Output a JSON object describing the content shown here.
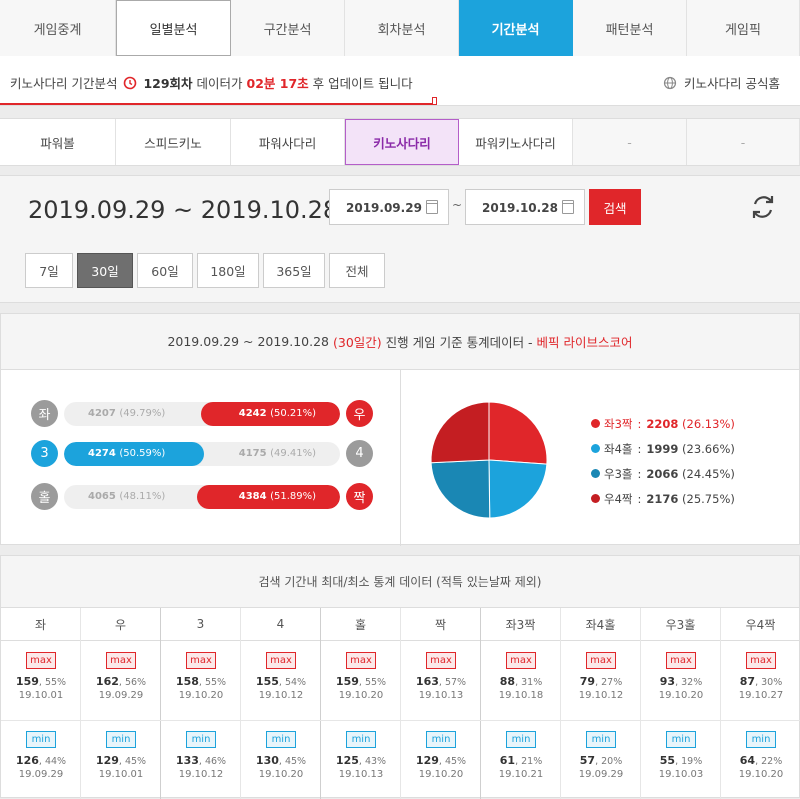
{
  "top_tabs": [
    "게임중계",
    "일별분석",
    "구간분석",
    "회차분석",
    "기간분석",
    "패턴분석",
    "게임픽"
  ],
  "info": {
    "prefix": "키노사다리 기간분석",
    "round": "129회차",
    "mid": "데이터가",
    "time": "02분 17초",
    "suffix": "후 업데이트 됩니다",
    "official_link": "키노사다리 공식홈"
  },
  "game_tabs": [
    "파워볼",
    "스피드키노",
    "파워사다리",
    "키노사다리",
    "파워키노사다리",
    "-",
    "-"
  ],
  "date": {
    "range": "2019.09.29 ~ 2019.10.28",
    "start": "2019.09.29",
    "tilde": "~",
    "end": "2019.10.28",
    "search_label": "검색"
  },
  "periods": [
    "7일",
    "30일",
    "60일",
    "180일",
    "365일",
    "전체"
  ],
  "stats": {
    "range": "2019.09.29 ~ 2019.10.28",
    "days": "(30일간)",
    "mid": "진행 게임 기준 통계데이터 -",
    "source": "베픽 라이브스코어",
    "rows": [
      {
        "left_label": "좌",
        "right_label": "우",
        "left_val": "4207",
        "left_pct": "(49.79%)",
        "right_val": "4242",
        "right_pct": "(50.21%)",
        "winner": "right",
        "win_color": "red",
        "pct": 50.21
      },
      {
        "left_label": "3",
        "right_label": "4",
        "left_val": "4274",
        "left_pct": "(50.59%)",
        "right_val": "4175",
        "right_pct": "(49.41%)",
        "winner": "left",
        "win_color": "blue",
        "pct": 50.59
      },
      {
        "left_label": "홀",
        "right_label": "짝",
        "left_val": "4065",
        "left_pct": "(48.11%)",
        "right_val": "4384",
        "right_pct": "(51.89%)",
        "winner": "right",
        "win_color": "red",
        "pct": 51.89
      }
    ]
  },
  "chart_data": {
    "type": "pie",
    "series": [
      {
        "name": "좌3짝",
        "value": 2208,
        "pct": "(26.13%)",
        "color": "#e0262a"
      },
      {
        "name": "좌4홀",
        "value": 1999,
        "pct": "(23.66%)",
        "color": "#1ca3dc"
      },
      {
        "name": "우3홀",
        "value": 2066,
        "pct": "(24.45%)",
        "color": "#1a87b4"
      },
      {
        "name": "우4짝",
        "value": 2176,
        "pct": "(25.75%)",
        "color": "#c41e22"
      }
    ]
  },
  "minmax": {
    "title": "검색 기간내 최대/최소 통계 데이터 (적특 있는날짜 제외)",
    "max_label": "max",
    "min_label": "min",
    "columns": [
      {
        "h": "좌",
        "max_v": "159",
        "max_p": "55%",
        "max_d": "19.10.01",
        "min_v": "126",
        "min_p": "44%",
        "min_d": "19.09.29"
      },
      {
        "h": "우",
        "max_v": "162",
        "max_p": "56%",
        "max_d": "19.09.29",
        "min_v": "129",
        "min_p": "45%",
        "min_d": "19.10.01"
      },
      {
        "h": "3",
        "max_v": "158",
        "max_p": "55%",
        "max_d": "19.10.20",
        "min_v": "133",
        "min_p": "46%",
        "min_d": "19.10.12"
      },
      {
        "h": "4",
        "max_v": "155",
        "max_p": "54%",
        "max_d": "19.10.12",
        "min_v": "130",
        "min_p": "45%",
        "min_d": "19.10.20"
      },
      {
        "h": "홀",
        "max_v": "159",
        "max_p": "55%",
        "max_d": "19.10.20",
        "min_v": "125",
        "min_p": "43%",
        "min_d": "19.10.13"
      },
      {
        "h": "짝",
        "max_v": "163",
        "max_p": "57%",
        "max_d": "19.10.13",
        "min_v": "129",
        "min_p": "45%",
        "min_d": "19.10.20"
      },
      {
        "h": "좌3짝",
        "max_v": "88",
        "max_p": "31%",
        "max_d": "19.10.18",
        "min_v": "61",
        "min_p": "21%",
        "min_d": "19.10.21"
      },
      {
        "h": "좌4홀",
        "max_v": "79",
        "max_p": "27%",
        "max_d": "19.10.12",
        "min_v": "57",
        "min_p": "20%",
        "min_d": "19.09.29"
      },
      {
        "h": "우3홀",
        "max_v": "93",
        "max_p": "32%",
        "max_d": "19.10.20",
        "min_v": "55",
        "min_p": "19%",
        "min_d": "19.10.03"
      },
      {
        "h": "우4짝",
        "max_v": "87",
        "max_p": "30%",
        "max_d": "19.10.27",
        "min_v": "64",
        "min_p": "22%",
        "min_d": "19.10.20"
      }
    ]
  }
}
